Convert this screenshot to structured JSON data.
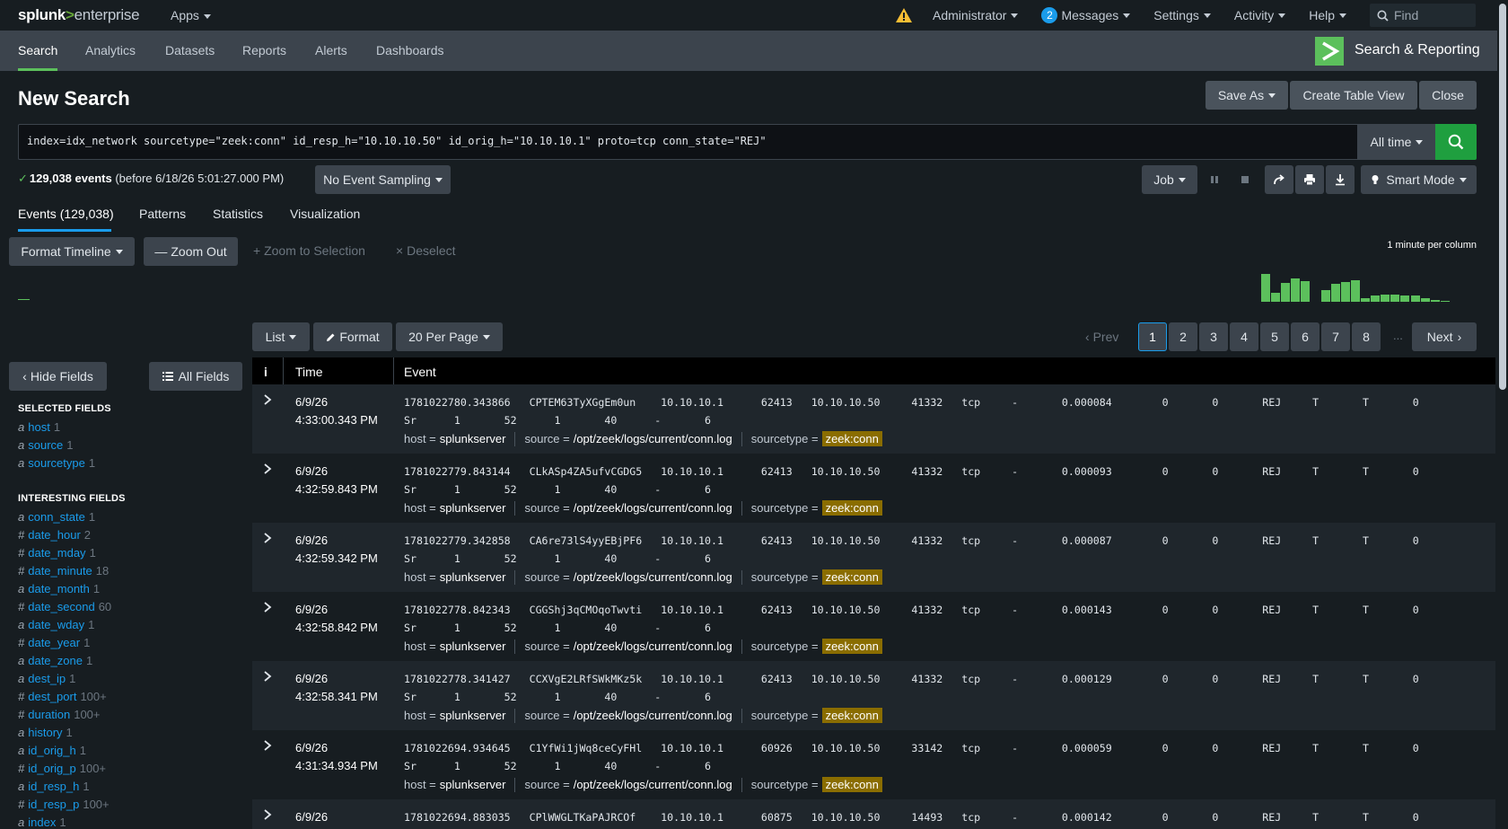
{
  "topbar": {
    "logo_splunk": "splunk",
    "logo_gt": ">",
    "logo_product": "enterprise",
    "apps": "Apps",
    "user": "Administrator",
    "messages_count": "2",
    "messages": "Messages",
    "settings": "Settings",
    "activity": "Activity",
    "help": "Help",
    "find_placeholder": "Find"
  },
  "appnav": {
    "items": [
      "Search",
      "Analytics",
      "Datasets",
      "Reports",
      "Alerts",
      "Dashboards"
    ],
    "app_title": "Search & Reporting",
    "accent": "#5cc05c"
  },
  "page": {
    "title": "New Search",
    "save_as": "Save As",
    "create_table_view": "Create Table View",
    "close": "Close"
  },
  "search": {
    "query": "index=idx_network sourcetype=\"zeek:conn\" id_resp_h=\"10.10.10.50\" id_orig_h=\"10.10.10.1\" proto=tcp conn_state=\"REJ\"",
    "time_range": "All time"
  },
  "status": {
    "count": "129,038 events",
    "before": "(before 6/18/26 5:01:27.000 PM)",
    "sampling": "No Event Sampling",
    "job": "Job",
    "mode": "Smart Mode"
  },
  "tabs": [
    "Events (129,038)",
    "Patterns",
    "Statistics",
    "Visualization"
  ],
  "timeline": {
    "format_timeline": "Format Timeline",
    "zoom_out": "Zoom Out",
    "zoom_to_selection": "Zoom to Selection",
    "deselect": "Deselect",
    "scale_note": "1 minute per column",
    "bars": [
      0.95,
      0.3,
      0.65,
      0.78,
      0.7,
      0,
      0.38,
      0.62,
      0.68,
      0.72,
      0.12,
      0.22,
      0.24,
      0.24,
      0.22,
      0.2,
      0.12,
      0.05,
      0.04
    ]
  },
  "results_controls": {
    "list": "List",
    "format": "Format",
    "per_page": "20 Per Page",
    "prev": "Prev",
    "pages": [
      "1",
      "2",
      "3",
      "4",
      "5",
      "6",
      "7",
      "8"
    ],
    "ellipsis": "...",
    "next": "Next"
  },
  "fields": {
    "hide_fields": "Hide Fields",
    "all_fields": "All Fields",
    "selected_heading": "SELECTED FIELDS",
    "selected": [
      {
        "type": "a",
        "name": "host",
        "count": "1"
      },
      {
        "type": "a",
        "name": "source",
        "count": "1"
      },
      {
        "type": "a",
        "name": "sourcetype",
        "count": "1"
      }
    ],
    "interesting_heading": "INTERESTING FIELDS",
    "interesting": [
      {
        "type": "a",
        "name": "conn_state",
        "count": "1"
      },
      {
        "type": "#",
        "name": "date_hour",
        "count": "2"
      },
      {
        "type": "#",
        "name": "date_mday",
        "count": "1"
      },
      {
        "type": "#",
        "name": "date_minute",
        "count": "18"
      },
      {
        "type": "a",
        "name": "date_month",
        "count": "1"
      },
      {
        "type": "#",
        "name": "date_second",
        "count": "60"
      },
      {
        "type": "a",
        "name": "date_wday",
        "count": "1"
      },
      {
        "type": "#",
        "name": "date_year",
        "count": "1"
      },
      {
        "type": "a",
        "name": "date_zone",
        "count": "1"
      },
      {
        "type": "a",
        "name": "dest_ip",
        "count": "1"
      },
      {
        "type": "#",
        "name": "dest_port",
        "count": "100+"
      },
      {
        "type": "#",
        "name": "duration",
        "count": "100+"
      },
      {
        "type": "a",
        "name": "history",
        "count": "1"
      },
      {
        "type": "a",
        "name": "id_orig_h",
        "count": "1"
      },
      {
        "type": "#",
        "name": "id_orig_p",
        "count": "100+"
      },
      {
        "type": "a",
        "name": "id_resp_h",
        "count": "1"
      },
      {
        "type": "#",
        "name": "id_resp_p",
        "count": "100+"
      },
      {
        "type": "a",
        "name": "index",
        "count": "1"
      }
    ]
  },
  "events": {
    "header_info": "i",
    "header_time": "Time",
    "header_event": "Event",
    "host_label": "host =",
    "source_label": "source =",
    "sourcetype_label": "sourcetype =",
    "rows": [
      {
        "date": "6/9/26",
        "time": "4:33:00.343 PM",
        "raw1": "1781022780.343866   CPTEM63TyXGgEm0un    10.10.10.1      62413   10.10.10.50     41332   tcp     -       0.000084        0       0       REJ     T       T       0",
        "raw2": "Sr      1       52      1       40      -       6",
        "host": "splunkserver",
        "source": "/opt/zeek/logs/current/conn.log",
        "sourcetype": "zeek:conn"
      },
      {
        "date": "6/9/26",
        "time": "4:32:59.843 PM",
        "raw1": "1781022779.843144   CLkASp4ZA5ufvCGDG5   10.10.10.1      62413   10.10.10.50     41332   tcp     -       0.000093        0       0       REJ     T       T       0",
        "raw2": "Sr      1       52      1       40      -       6",
        "host": "splunkserver",
        "source": "/opt/zeek/logs/current/conn.log",
        "sourcetype": "zeek:conn"
      },
      {
        "date": "6/9/26",
        "time": "4:32:59.342 PM",
        "raw1": "1781022779.342858   CA6re73lS4yyEBjPF6   10.10.10.1      62413   10.10.10.50     41332   tcp     -       0.000087        0       0       REJ     T       T       0",
        "raw2": "Sr      1       52      1       40      -       6",
        "host": "splunkserver",
        "source": "/opt/zeek/logs/current/conn.log",
        "sourcetype": "zeek:conn"
      },
      {
        "date": "6/9/26",
        "time": "4:32:58.842 PM",
        "raw1": "1781022778.842343   CGGShj3qCMOqoTwvti   10.10.10.1      62413   10.10.10.50     41332   tcp     -       0.000143        0       0       REJ     T       T       0",
        "raw2": "Sr      1       52      1       40      -       6",
        "host": "splunkserver",
        "source": "/opt/zeek/logs/current/conn.log",
        "sourcetype": "zeek:conn"
      },
      {
        "date": "6/9/26",
        "time": "4:32:58.341 PM",
        "raw1": "1781022778.341427   CCXVgE2LRfSWkMKz5k   10.10.10.1      62413   10.10.10.50     41332   tcp     -       0.000129        0       0       REJ     T       T       0",
        "raw2": "Sr      1       52      1       40      -       6",
        "host": "splunkserver",
        "source": "/opt/zeek/logs/current/conn.log",
        "sourcetype": "zeek:conn"
      },
      {
        "date": "6/9/26",
        "time": "4:31:34.934 PM",
        "raw1": "1781022694.934645   C1YfWi1jWq8ceCyFHl   10.10.10.1      60926   10.10.10.50     33142   tcp     -       0.000059        0       0       REJ     T       T       0",
        "raw2": "Sr      1       52      1       40      -       6",
        "host": "splunkserver",
        "source": "/opt/zeek/logs/current/conn.log",
        "sourcetype": "zeek:conn"
      },
      {
        "date": "6/9/26",
        "time": "",
        "raw1": "1781022694.883035   CPlWWGLTKaPAJRCOf    10.10.10.1      60875   10.10.10.50     14493   tcp     -       0.000142        0       0       REJ     T       T       0",
        "raw2": "",
        "host": "",
        "source": "",
        "sourcetype": ""
      }
    ]
  }
}
